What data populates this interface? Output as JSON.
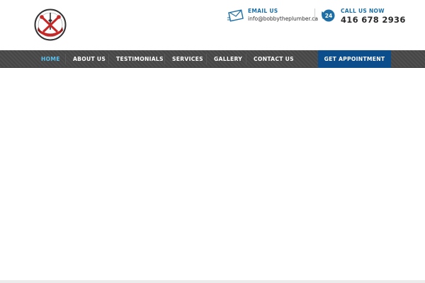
{
  "header": {
    "email": {
      "label": "EMAIL US",
      "value": "info@bobbytheplumber.ca",
      "icon": "envelope-icon"
    },
    "phone": {
      "label": "CALL US NOW",
      "value": "416 678 2936",
      "icon": "phone-24-icon",
      "badge": "24"
    }
  },
  "nav": {
    "items": [
      {
        "label": "HOME",
        "active": true
      },
      {
        "label": "ABOUT US",
        "active": false
      },
      {
        "label": "TESTIMONIALS",
        "active": false
      },
      {
        "label": "SERVICES",
        "active": false
      },
      {
        "label": "GALLERY",
        "active": false
      },
      {
        "label": "CONTACT US",
        "active": false
      }
    ],
    "cta_label": "GET APPOINTMENT"
  },
  "colors": {
    "nav_bg": "#4a4a4a",
    "active": "#5bc0eb",
    "cta_bg": "#0c4d8b",
    "accent_blue": "#1d6fa5",
    "logo_red": "#c62828"
  }
}
